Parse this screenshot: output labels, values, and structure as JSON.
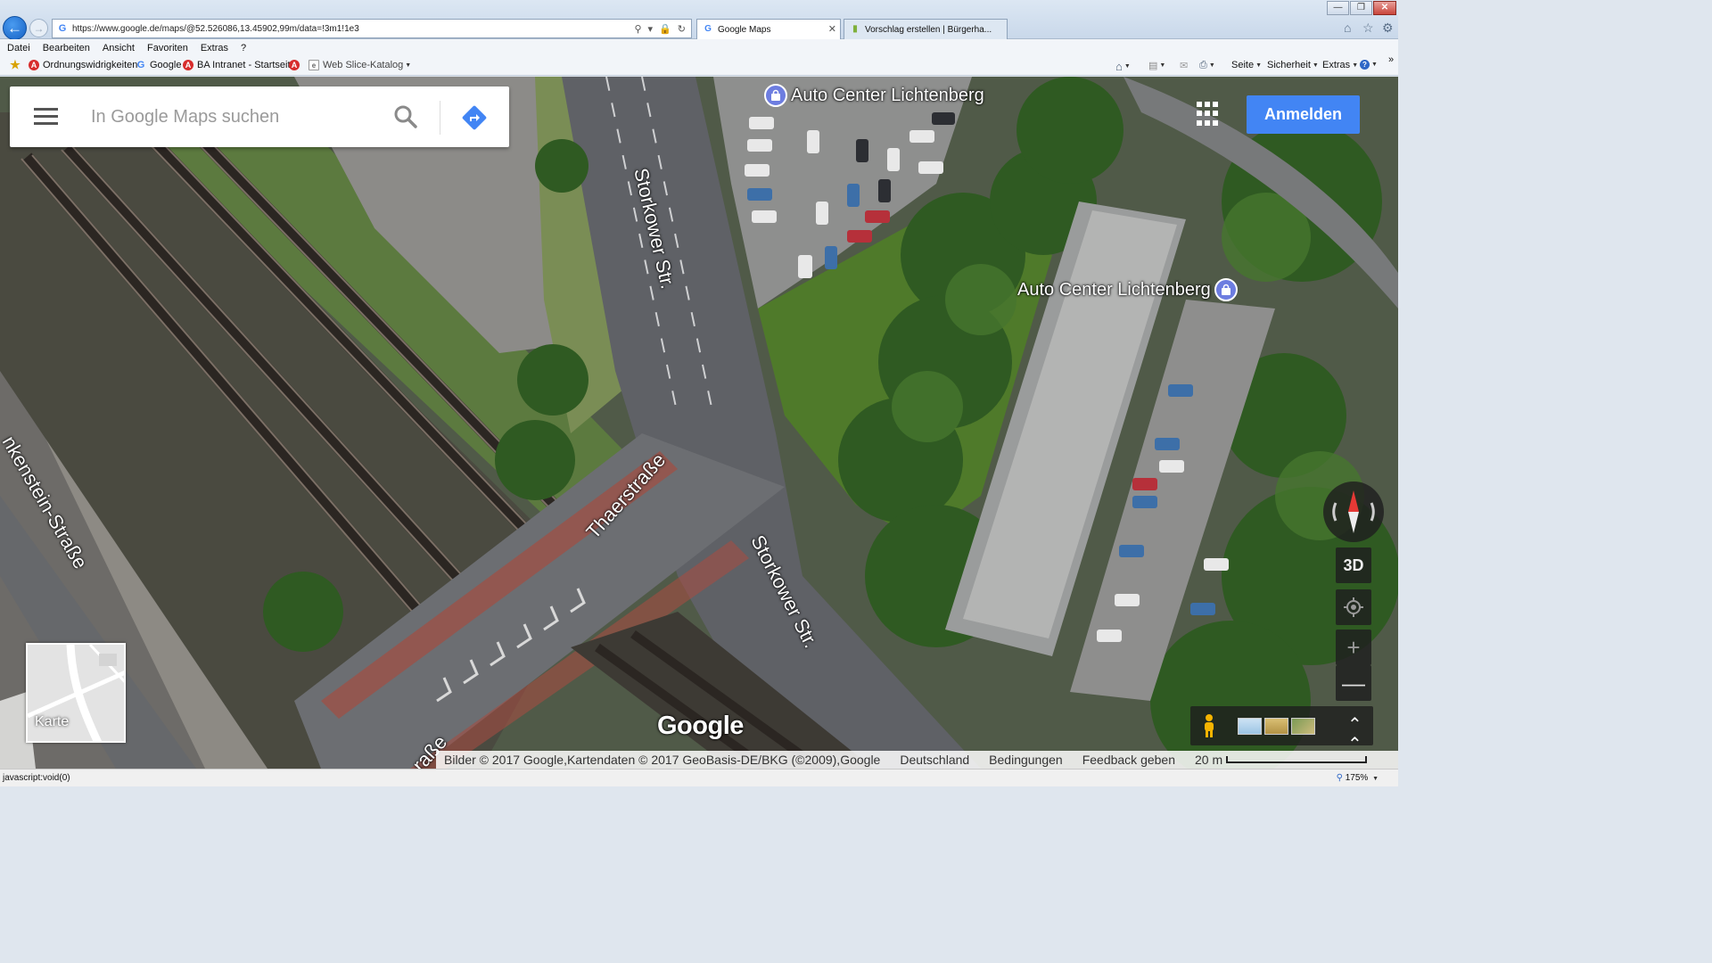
{
  "browser": {
    "url": "https://www.google.de/maps/@52.526086,13.45902,99m/data=!3m1!1e3",
    "tabs": [
      {
        "label": "Google Maps",
        "favicon": "google-icon",
        "active": true
      },
      {
        "label": "Vorschlag erstellen | Bürgerha...",
        "favicon": "page-icon",
        "active": false
      }
    ],
    "menu": [
      "Datei",
      "Bearbeiten",
      "Ansicht",
      "Favoriten",
      "Extras",
      "?"
    ],
    "favorites": [
      {
        "label": "Ordnungswidrigkeiten",
        "icon": "red-a-icon"
      },
      {
        "label": "Google",
        "icon": "google-icon"
      },
      {
        "label": "BA Intranet - Startseite",
        "icon": "red-a-icon"
      },
      {
        "label": "",
        "icon": "red-a-icon"
      },
      {
        "label": "Web Slice-Katalog",
        "icon": "web-slice-icon"
      }
    ],
    "command_bar": {
      "page": "Seite",
      "security": "Sicherheit",
      "tools": "Extras"
    },
    "status_text": "javascript:void(0)",
    "zoom": "175%"
  },
  "maps": {
    "search_placeholder": "In Google Maps suchen",
    "signin_label": "Anmelden",
    "poi": [
      "Auto Center Lichtenberg",
      "Auto Center Lichtenberg"
    ],
    "streets": {
      "storkower_north": "Storkower Str.",
      "storkower_south": "Storkower Str.",
      "thaerstrasse": "Thaerstraße",
      "weissenstein": "nkenstein-Straße",
      "bottom_partial": "raße"
    },
    "minimap_label": "Karte",
    "btn_3d": "3D",
    "logo": "Google",
    "footer": {
      "attribution": "Bilder © 2017 Google,Kartendaten © 2017 GeoBasis-DE/BKG (©2009),Google",
      "country": "Deutschland",
      "terms": "Bedingungen",
      "feedback": "Feedback geben",
      "scale": "20 m"
    },
    "colors": {
      "accent": "#4285f4",
      "poi_pin": "#6d7de0",
      "compass_red": "#e53935"
    }
  }
}
